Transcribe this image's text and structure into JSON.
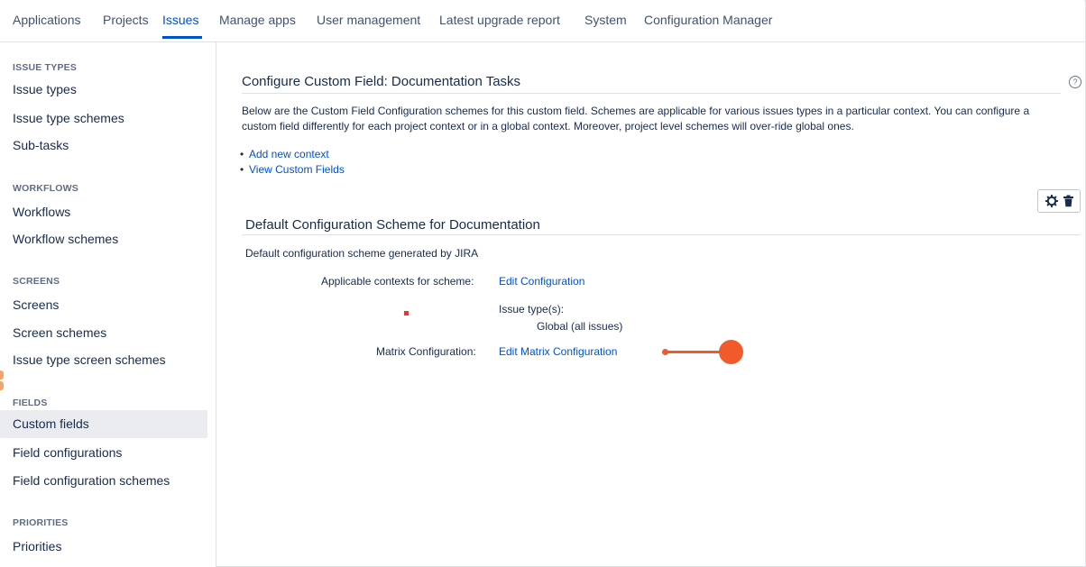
{
  "topnav": {
    "tabs": [
      {
        "label": "Applications"
      },
      {
        "label": "Projects"
      },
      {
        "label": "Issues",
        "active": true
      },
      {
        "label": "Manage apps"
      },
      {
        "label": "User management"
      },
      {
        "label": "Latest upgrade report"
      },
      {
        "label": "System"
      },
      {
        "label": "Configuration Manager"
      }
    ]
  },
  "sidebar": {
    "issue_types": {
      "heading": "ISSUE TYPES",
      "items": [
        "Issue types",
        "Issue type schemes",
        "Sub-tasks"
      ]
    },
    "workflows": {
      "heading": "WORKFLOWS",
      "items": [
        "Workflows",
        "Workflow schemes"
      ]
    },
    "screens": {
      "heading": "SCREENS",
      "items": [
        "Screens",
        "Screen schemes",
        "Issue type screen schemes"
      ]
    },
    "fields": {
      "heading": "FIELDS",
      "items": [
        "Custom fields",
        "Field configurations",
        "Field configuration schemes"
      ],
      "selected": "Custom fields"
    },
    "priorities": {
      "heading": "PRIORITIES",
      "items": [
        "Priorities"
      ]
    }
  },
  "main": {
    "title": "Configure Custom Field: Documentation Tasks",
    "help_icon_glyph": "?",
    "description": "Below are the Custom Field Configuration schemes for this custom field. Schemes are applicable for various issues types in a particular context. You can configure a custom field differently for each project context or in a global context. Moreover, project level schemes will over-ride global ones.",
    "links": [
      "Add new context",
      "View Custom Fields"
    ],
    "bullet": "•",
    "icons": {
      "settings": "gear-icon",
      "delete": "trash-icon"
    },
    "scheme": {
      "title": "Default Configuration Scheme for Documentation",
      "description": "Default configuration scheme generated by JIRA",
      "applicable_label": "Applicable contexts for scheme:",
      "applicable_link": "Edit Configuration",
      "issue_types_label": "Issue type(s):",
      "issue_types_value": "Global (all issues)",
      "matrix_label": "Matrix Configuration:",
      "matrix_link": "Edit Matrix Configuration"
    }
  },
  "colors": {
    "link": "#0052cc",
    "text": "#172b4d",
    "annotation": "#f15a2b",
    "selected_bg": "#ebecf0"
  }
}
